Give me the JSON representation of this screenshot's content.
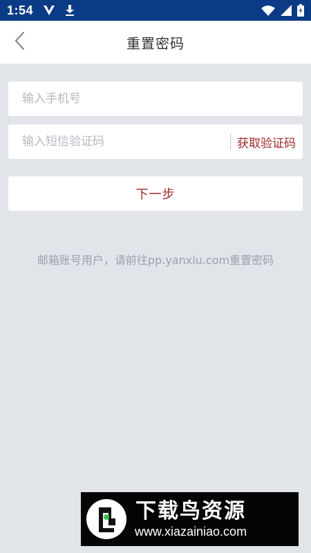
{
  "status_bar": {
    "time": "1:54",
    "left_icons": [
      "vee-logo-icon",
      "download-icon"
    ],
    "right_icons": [
      "wifi-icon",
      "signal-icon",
      "battery-icon"
    ]
  },
  "header": {
    "title": "重置密码",
    "back_icon": "chevron-left-icon"
  },
  "form": {
    "phone_placeholder": "输入手机号",
    "phone_value": "",
    "code_placeholder": "输入短信验证码",
    "code_value": "",
    "get_code_label": "获取验证码",
    "next_label": "下一步"
  },
  "hint": "邮箱账号用户，请前往pp.yanxiu.com重置密码",
  "watermark": {
    "title": "下载鸟资源",
    "url": "www.xiazainiao.com"
  },
  "colors": {
    "status_bar": "#0b3b86",
    "background": "#e1e4e9",
    "accent": "#a02828",
    "hint": "#9da2aa"
  }
}
